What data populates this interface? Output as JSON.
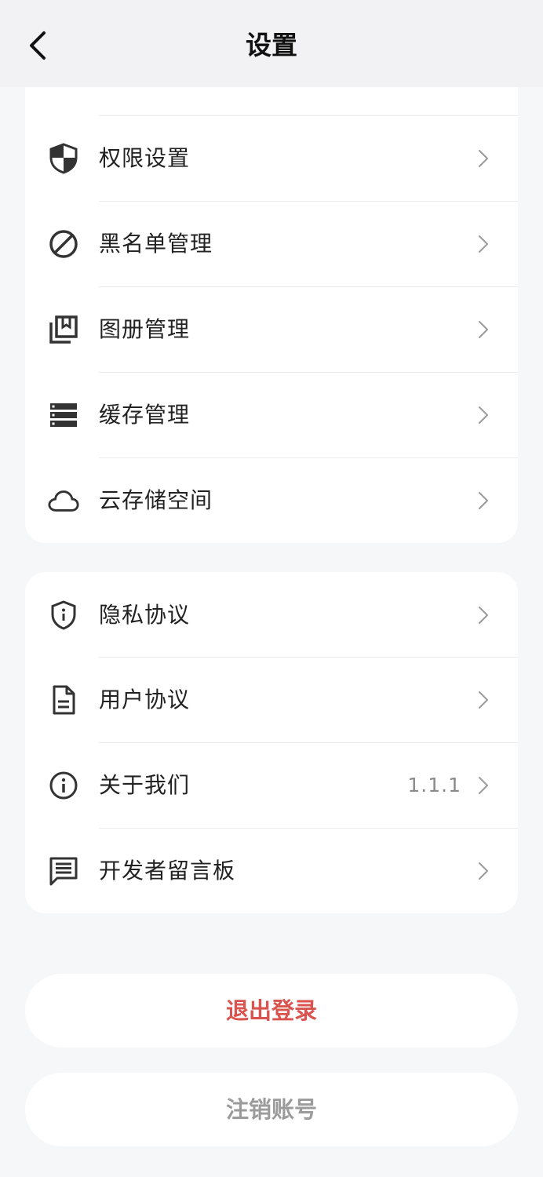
{
  "header": {
    "title": "设置"
  },
  "colors": {
    "accent_red": "#d9534f",
    "muted_gray": "#9b9b9b",
    "background": "#f6f7f9"
  },
  "card1": {
    "items": [
      {
        "label": "权限设置",
        "icon": "shield-icon"
      },
      {
        "label": "黑名单管理",
        "icon": "block-icon"
      },
      {
        "label": "图册管理",
        "icon": "album-icon"
      },
      {
        "label": "缓存管理",
        "icon": "storage-icon"
      },
      {
        "label": "云存储空间",
        "icon": "cloud-icon"
      }
    ]
  },
  "card2": {
    "items": [
      {
        "label": "隐私协议",
        "icon": "privacy-shield-icon"
      },
      {
        "label": "用户协议",
        "icon": "document-icon"
      },
      {
        "label": "关于我们",
        "icon": "info-icon",
        "value": "1.1.1"
      },
      {
        "label": "开发者留言板",
        "icon": "message-icon"
      }
    ]
  },
  "actions": {
    "logout_label": "退出登录",
    "deregister_label": "注销账号"
  }
}
